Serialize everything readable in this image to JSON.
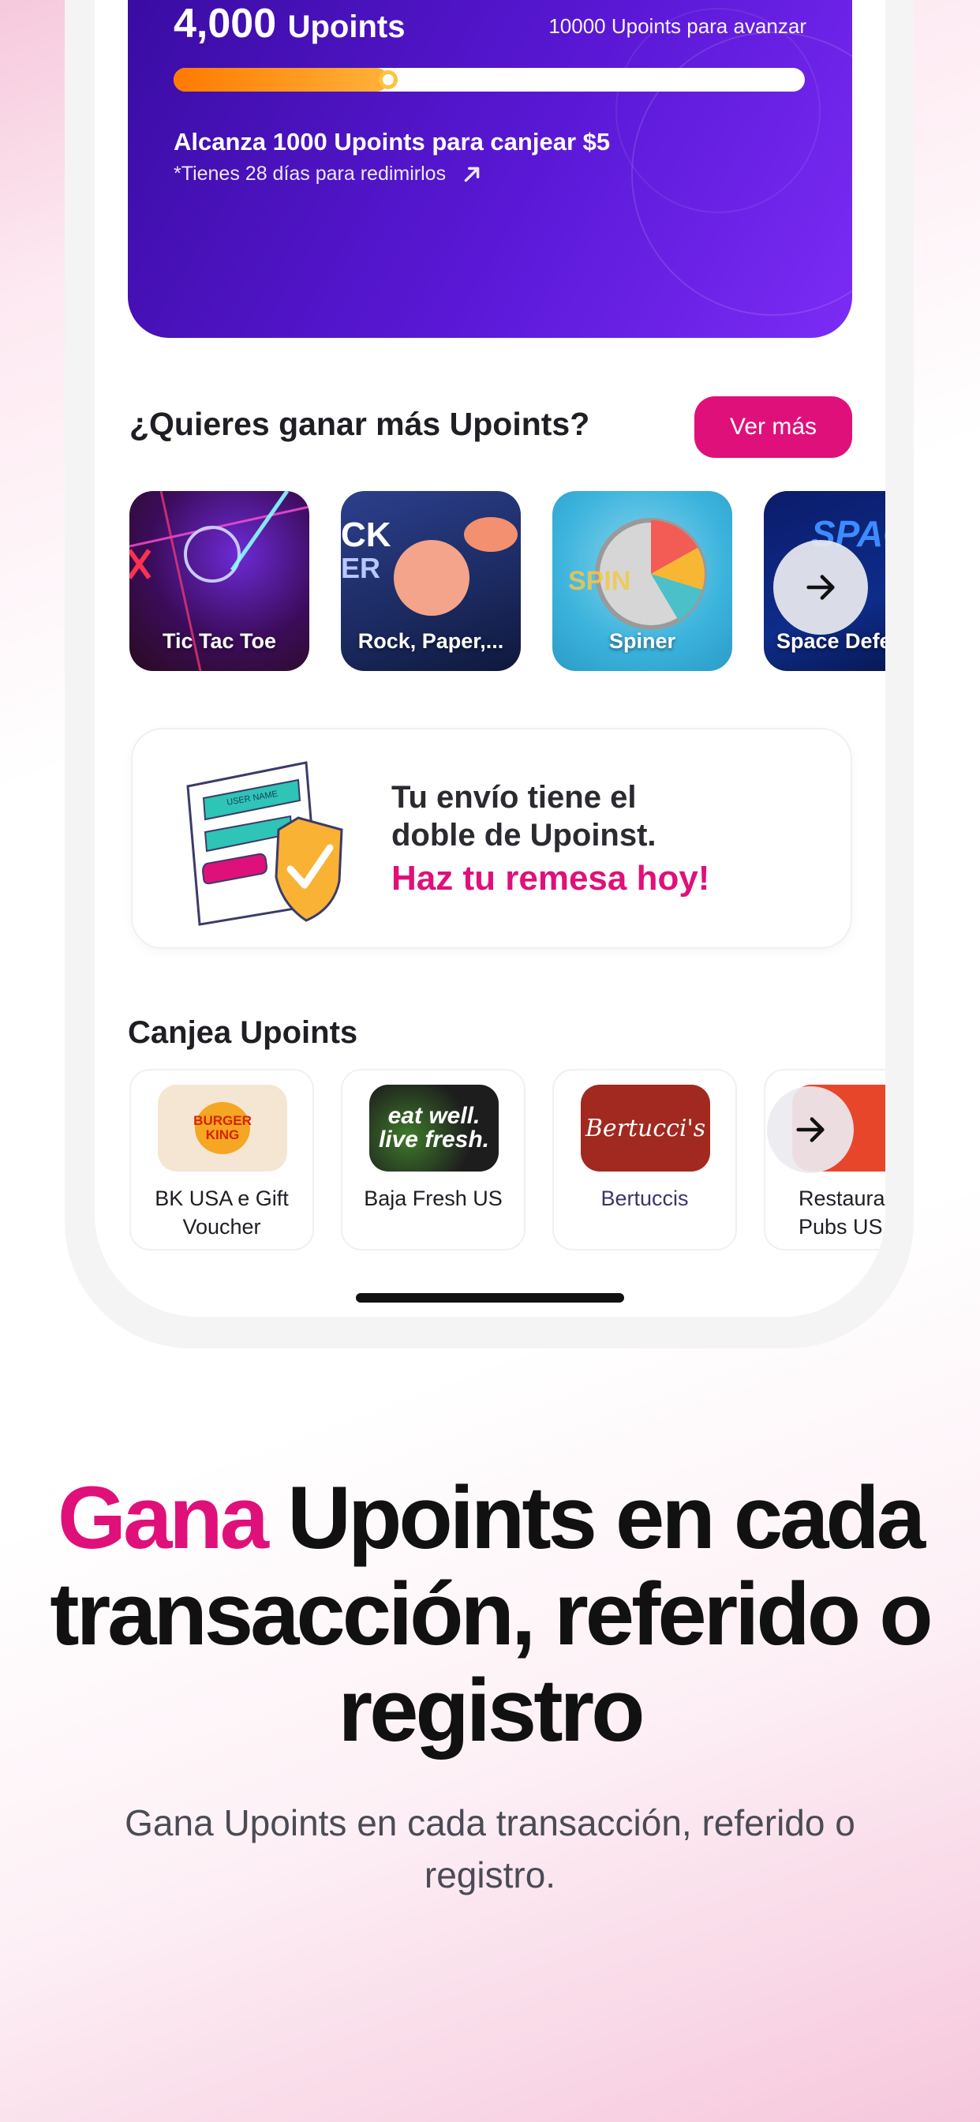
{
  "points_card": {
    "points_value": "4,000",
    "points_unit": "Upoints",
    "advance_text": "10000 Upoints para avanzar",
    "progress_fraction": 0.34,
    "reach_title": "Alcanza 1000 Upoints para canjear $5",
    "reach_subtitle": "*Tienes 28 días para redimirlos"
  },
  "earn_more": {
    "title": "¿Quieres ganar más Upoints?",
    "button_label": "Ver más",
    "games": [
      {
        "label": "Tic Tac Toe"
      },
      {
        "label": "Rock, Paper,..."
      },
      {
        "label": "Spiner"
      },
      {
        "label": "Space Defe"
      }
    ]
  },
  "promo": {
    "line1": "Tu envío tiene el",
    "line2": "doble de Upoinst.",
    "cta": "Haz tu remesa hoy!",
    "illustration_text": "USER NAME"
  },
  "redeem": {
    "title": "Canjea Upoints",
    "rewards": [
      {
        "name": "BK USA e Gift Voucher",
        "logo_text": [
          "BURGER",
          "KING"
        ]
      },
      {
        "name": "Baja Fresh US",
        "logo_text": [
          "eat well.",
          "live fresh."
        ]
      },
      {
        "name": "Bertuccis",
        "logo_text": [
          "Bertucci's"
        ]
      },
      {
        "name": "Restaurar Pubs US",
        "logo_text": [
          ""
        ]
      }
    ]
  },
  "marketing": {
    "headline_accent": "Gana",
    "headline_rest": " Upoints en cada transacción, referido o registro",
    "subline": "Gana Upoints en cada transacción, referido o registro."
  },
  "colors": {
    "brand_pink": "#e0107a",
    "card_purple": "#5a18d6",
    "progress_orange": "#ff7a00"
  },
  "icons": [
    "arrow-up-right-icon",
    "arrow-right-icon"
  ]
}
